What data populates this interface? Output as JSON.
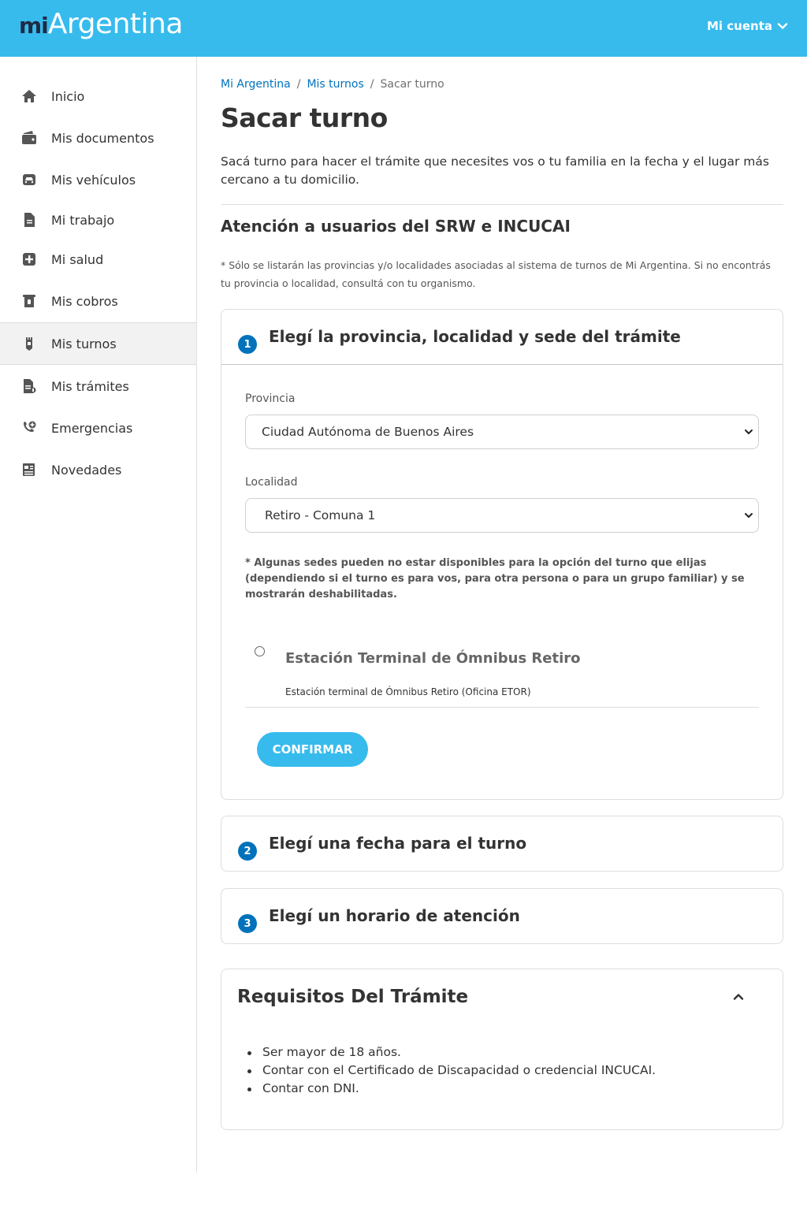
{
  "header": {
    "logo_mi": "mi",
    "logo_argentina": "Argentina",
    "account_label": "Mi cuenta",
    "brand_color": "#37bbed"
  },
  "sidebar": {
    "items": [
      {
        "label": "Inicio",
        "icon": "home-icon"
      },
      {
        "label": "Mis documentos",
        "icon": "wallet-icon"
      },
      {
        "label": "Mis vehículos",
        "icon": "car-icon"
      },
      {
        "label": "Mi trabajo",
        "icon": "document-icon"
      },
      {
        "label": "Mi salud",
        "icon": "health-cross-icon"
      },
      {
        "label": "Mis cobros",
        "icon": "receipt-icon"
      },
      {
        "label": "Mis turnos",
        "icon": "ticket-icon",
        "active": true
      },
      {
        "label": "Mis trámites",
        "icon": "file-list-icon"
      },
      {
        "label": "Emergencias",
        "icon": "phone-plus-icon"
      },
      {
        "label": "Novedades",
        "icon": "newspaper-icon"
      }
    ]
  },
  "breadcrumb": {
    "home": "Mi Argentina",
    "section": "Mis turnos",
    "current": "Sacar turno",
    "separator": "/"
  },
  "page": {
    "title": "Sacar turno",
    "intro": "Sacá turno para hacer el trámite que necesites vos o tu familia en la fecha y el lugar más cercano a tu domicilio.",
    "section_title": "Atención a usuarios del SRW e INCUCAI",
    "note": "* Sólo se listarán las provincias y/o localidades asociadas al sistema de turnos de Mi Argentina. Si no encontrás tu provincia o localidad, consultá con tu organismo."
  },
  "step1": {
    "number": "1",
    "title": "Elegí la provincia, localidad y sede del trámite",
    "provincia_label": "Provincia",
    "provincia_value": "Ciudad Autónoma de Buenos Aires",
    "localidad_label": "Localidad",
    "localidad_value": "Retiro - Comuna 1",
    "sede_note": "* Algunas sedes pueden no estar disponibles para la opción del turno que elijas (dependiendo si el turno es para vos, para otra persona o para un grupo familiar) y se mostrarán deshabilitadas.",
    "sede_name": "Estación Terminal de Ómnibus Retiro",
    "sede_detail": "Estación terminal de Ómnibus Retiro (Oficina ETOR)",
    "confirm_label": "CONFIRMAR"
  },
  "step2": {
    "number": "2",
    "title": "Elegí una fecha para el turno"
  },
  "step3": {
    "number": "3",
    "title": "Elegí un horario de atención"
  },
  "requirements": {
    "title": "Requisitos Del Trámite",
    "items": [
      "Ser mayor de 18 años.",
      "Contar con el Certificado de Discapacidad o credencial INCUCAI.",
      "Contar con DNI."
    ]
  }
}
